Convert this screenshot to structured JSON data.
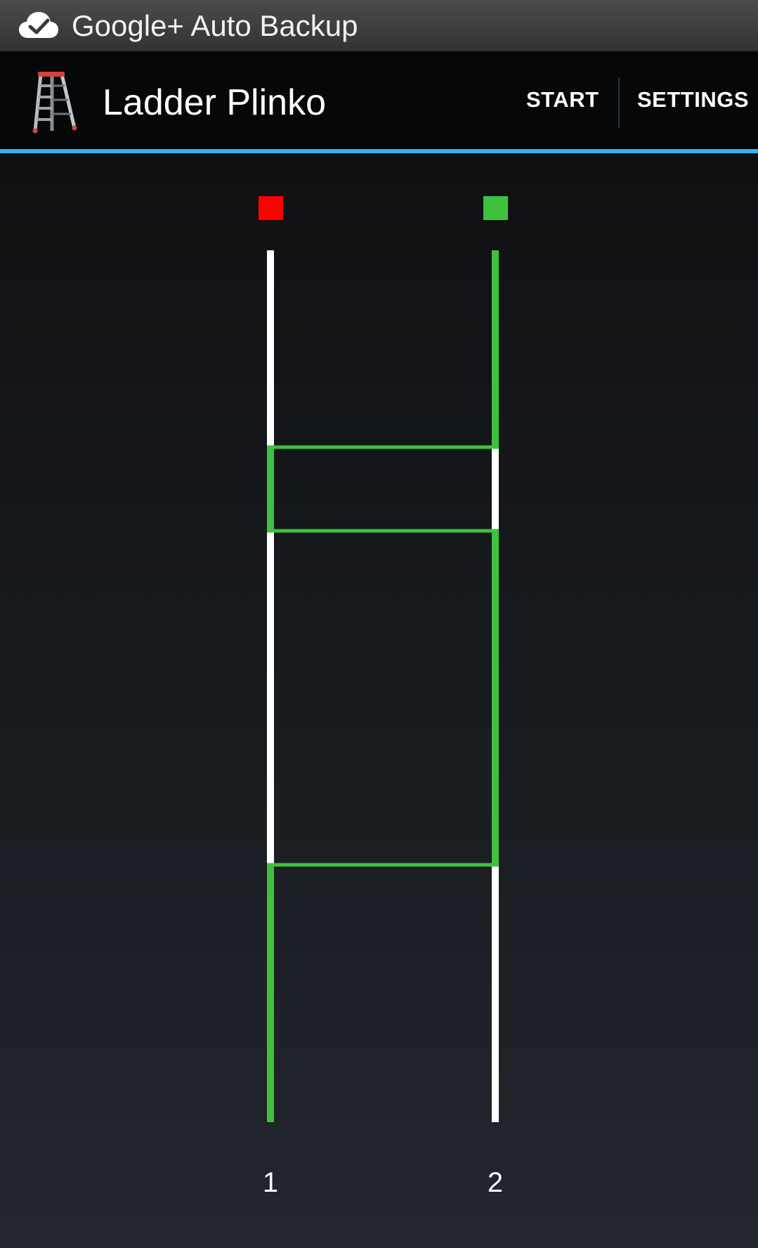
{
  "notification": {
    "icon": "cloud-check-icon",
    "text": "Google+ Auto Backup"
  },
  "action_bar": {
    "app_icon": "ladder-icon",
    "title": "Ladder Plinko",
    "start_label": "START",
    "settings_label": "SETTINGS"
  },
  "colors": {
    "accent": "#33b5e5",
    "path": "#3ec23e",
    "rail": "#ffffff",
    "marker_lane_1": "#ff0000",
    "marker_lane_2": "#3ec23e"
  },
  "ladder": {
    "lanes": [
      {
        "label": "1",
        "marker_color": "#ff0000"
      },
      {
        "label": "2",
        "marker_color": "#3ec23e"
      }
    ],
    "rungs_count": 3,
    "highlighted_start_lane": "2",
    "highlighted_end_lane": "1"
  }
}
